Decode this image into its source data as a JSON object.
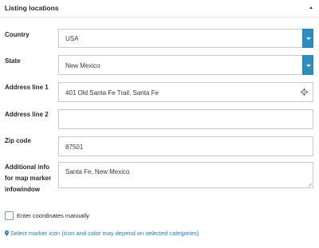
{
  "panel": {
    "title": "Listing locations",
    "collapse_icon": "triangle-up-icon"
  },
  "fields": {
    "country": {
      "label": "Country",
      "value": "USA"
    },
    "state": {
      "label": "State",
      "value": "New Mexico"
    },
    "address1": {
      "label": "Address line 1",
      "value": "401 Old Santa Fe Trail, Santa Fe",
      "icon": "crosshair-locate-icon"
    },
    "address2": {
      "label": "Address line 2",
      "value": ""
    },
    "zip": {
      "label": "Zip code",
      "value": "87501"
    },
    "additional": {
      "label": "Additional info for map marker infowindow",
      "value": "Santa Fe, New Mexico"
    }
  },
  "coordinates": {
    "label": "Enter coordinates manually",
    "checked": false
  },
  "marker_link": {
    "text": "Select marker icon (icon and color may depend on selected categories)",
    "icon": "map-pin-icon"
  },
  "colors": {
    "accent": "#2e8dbb",
    "link": "#2177b1",
    "border": "#c8c8c8"
  }
}
